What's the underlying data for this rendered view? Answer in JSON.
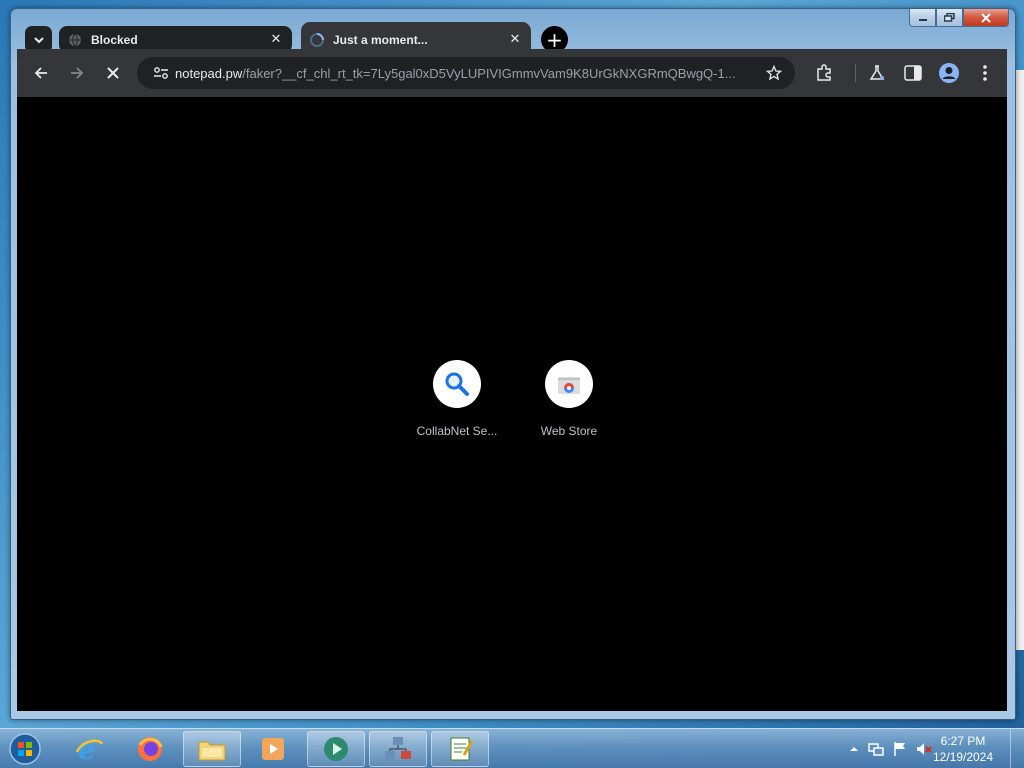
{
  "browser": {
    "tabs": [
      {
        "title": "Blocked",
        "active": false,
        "favicon": "globe-icon"
      },
      {
        "title": "Just a moment...",
        "active": true,
        "favicon": "loading-spinner-icon"
      }
    ],
    "address_bar": {
      "host": "notepad.pw",
      "path": "/faker?__cf_chl_rt_tk=7Ly5gal0xD5VyLUPIVIGmmvVam9K8UrGkNXGRmQBwgQ-1..."
    },
    "shortcuts": [
      {
        "label": "CollabNet Se...",
        "icon": "search-icon"
      },
      {
        "label": "Web Store",
        "icon": "web-store-icon"
      }
    ]
  },
  "taskbar": {
    "apps": [
      "start-orb",
      "internet-explorer",
      "firefox",
      "file-explorer",
      "media-player",
      "chrome-like-app",
      "network-app",
      "notepad-app"
    ],
    "clock": {
      "time": "6:27 PM",
      "date": "12/19/2024"
    }
  },
  "colors": {
    "tab_inactive": "#202124",
    "tab_active": "#35363a",
    "content_bg": "#000000",
    "accent_blue": "#1a73e8"
  }
}
